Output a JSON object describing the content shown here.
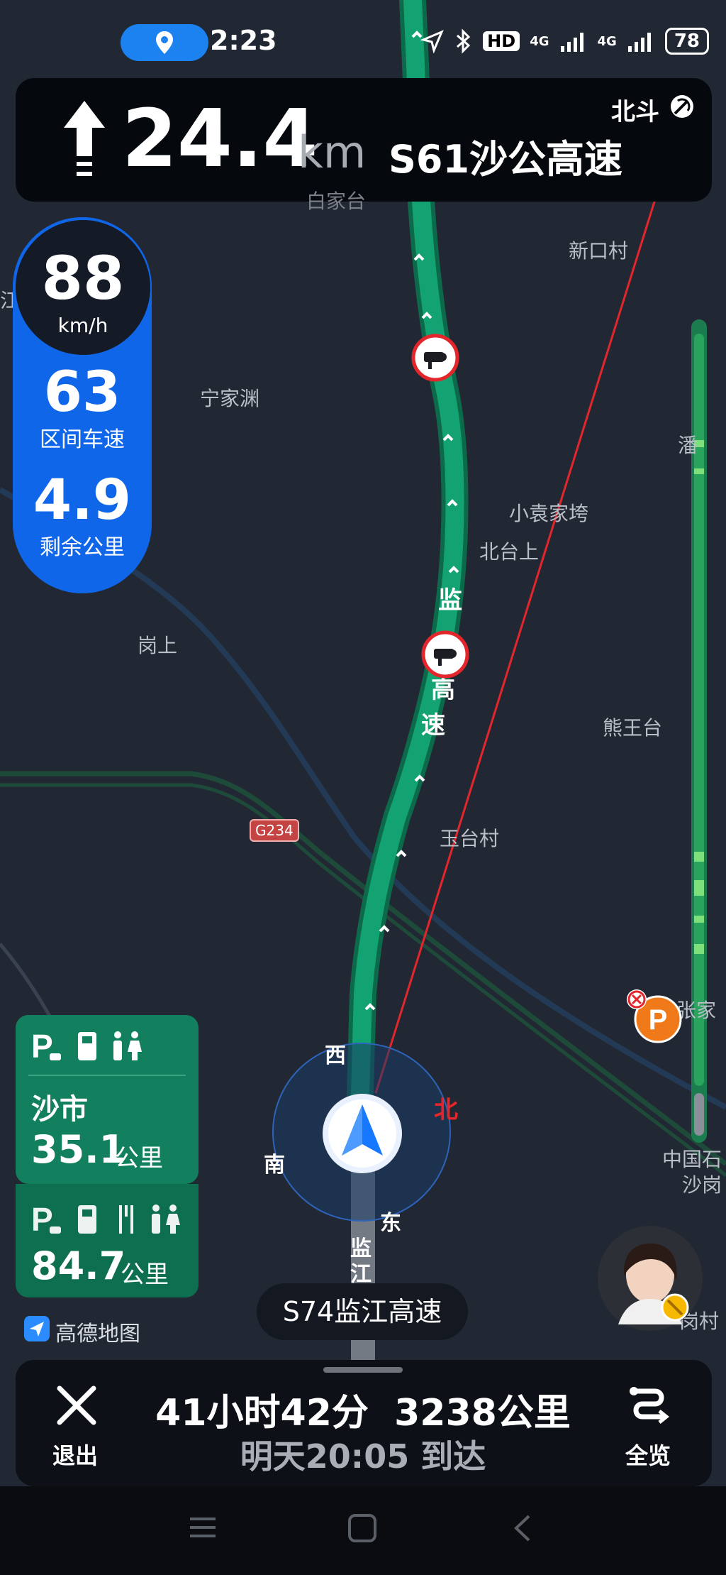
{
  "status_bar": {
    "time": "2:23",
    "network1": "4G",
    "network2": "4G",
    "hd_label": "HD",
    "battery": "78"
  },
  "guidance": {
    "distance": "24.4",
    "unit": "km",
    "next_road": "S61沙公高速",
    "satellite": "北斗"
  },
  "speed_panel": {
    "current_speed": "88",
    "speed_unit": "km/h",
    "section_speed": "63",
    "section_speed_label": "区间车速",
    "remaining": "4.9",
    "remaining_label": "剩余公里"
  },
  "map_labels": {
    "xinkou": "新口村",
    "ningjiayuan": "宁家渊",
    "pan": "潘",
    "xiaoyuanjiawan": "小袁家垮",
    "beitaishang": "北台上",
    "gangshang": "岗上",
    "xiongwangtai": "熊王台",
    "g234": "G234",
    "yutaicun": "玉台村",
    "zhangjia": "张家",
    "zhongguoshi": "中国石",
    "shagang": "沙岗",
    "gangcun": "岗村",
    "road_vertical1": "监",
    "road_vertical2": "高",
    "road_vertical3": "速",
    "road_below1": "监",
    "road_below2": "江",
    "cut_top": "白家台",
    "cut_left": "江"
  },
  "compass": {
    "west": "西",
    "north": "北",
    "south": "南",
    "east": "东"
  },
  "service_areas": [
    {
      "name": "沙市",
      "distance": "35.1",
      "unit": "公里"
    },
    {
      "distance": "84.7",
      "unit": "公里"
    }
  ],
  "brand": "高德地图",
  "current_road": "S74监江高速",
  "trip": {
    "summary": "41小时42分  3238公里",
    "arrival": "明天20:05 到达",
    "exit_label": "退出",
    "overview_label": "全览"
  },
  "colors": {
    "route": "#0f9a6c",
    "accent_blue": "#1066e8",
    "danger_red": "#e3262b"
  }
}
